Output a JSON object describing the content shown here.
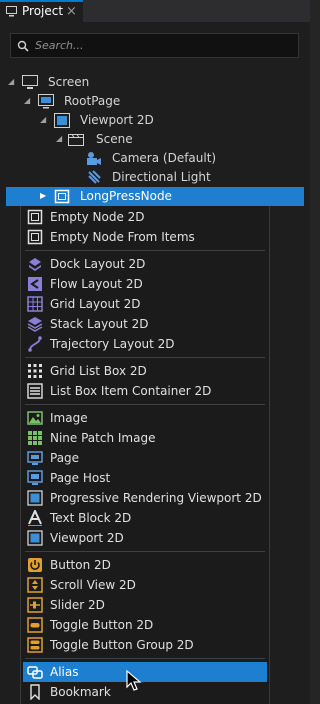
{
  "tab": {
    "title": "Project",
    "close": "×"
  },
  "search": {
    "placeholder": "Search..."
  },
  "tree": [
    {
      "label": "Screen",
      "icon": "monitor-icon"
    },
    {
      "label": "RootPage",
      "icon": "page-icon"
    },
    {
      "label": "Viewport 2D",
      "icon": "viewport-icon"
    },
    {
      "label": "Scene",
      "icon": "scene-icon"
    },
    {
      "label": "Camera (Default)",
      "icon": "camera-icon"
    },
    {
      "label": "Directional Light",
      "icon": "light-icon"
    },
    {
      "label": "LongPressNode",
      "icon": "node-icon"
    }
  ],
  "menu": {
    "items": [
      {
        "label": "Empty Node 2D",
        "icon": "empty-node-icon"
      },
      {
        "label": "Empty Node From Items",
        "icon": "empty-node-items-icon"
      },
      {
        "label": "Dock Layout 2D",
        "icon": "dock-layout-icon"
      },
      {
        "label": "Flow Layout 2D",
        "icon": "flow-layout-icon"
      },
      {
        "label": "Grid Layout 2D",
        "icon": "grid-layout-icon"
      },
      {
        "label": "Stack Layout 2D",
        "icon": "stack-layout-icon"
      },
      {
        "label": "Trajectory Layout 2D",
        "icon": "trajectory-layout-icon"
      },
      {
        "label": "Grid List Box 2D",
        "icon": "grid-list-box-icon"
      },
      {
        "label": "List Box Item Container 2D",
        "icon": "list-box-icon"
      },
      {
        "label": "Image",
        "icon": "image-icon"
      },
      {
        "label": "Nine Patch Image",
        "icon": "nine-patch-icon"
      },
      {
        "label": "Page",
        "icon": "page-icon"
      },
      {
        "label": "Page Host",
        "icon": "page-host-icon"
      },
      {
        "label": "Progressive Rendering Viewport 2D",
        "icon": "progressive-viewport-icon"
      },
      {
        "label": "Text Block 2D",
        "icon": "text-block-icon"
      },
      {
        "label": "Viewport 2D",
        "icon": "viewport-icon"
      },
      {
        "label": "Button 2D",
        "icon": "button-icon"
      },
      {
        "label": "Scroll View 2D",
        "icon": "scroll-view-icon"
      },
      {
        "label": "Slider 2D",
        "icon": "slider-icon"
      },
      {
        "label": "Toggle Button 2D",
        "icon": "toggle-button-icon"
      },
      {
        "label": "Toggle Button Group 2D",
        "icon": "toggle-group-icon"
      },
      {
        "label": "Alias",
        "icon": "alias-icon"
      },
      {
        "label": "Bookmark",
        "icon": "bookmark-icon"
      }
    ]
  },
  "colors": {
    "accent": "#1e7fd1",
    "tab_border": "#007acc",
    "menu_bg": "#1b1b1c"
  }
}
